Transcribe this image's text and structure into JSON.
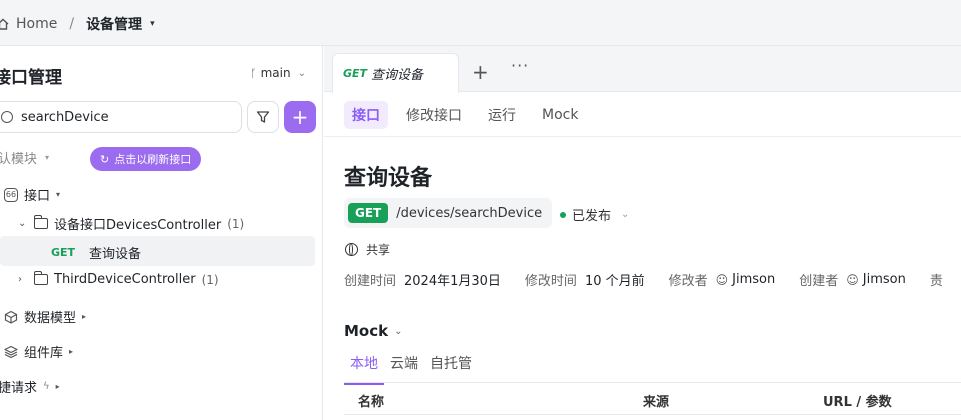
{
  "breadcrumb": {
    "home": "Home",
    "separator": "/",
    "current": "设备管理",
    "caret": "▾"
  },
  "sidebar": {
    "title": "接口管理",
    "branch": "main",
    "search": {
      "value": "searchDevice",
      "placeholder": ""
    },
    "module": "认模块",
    "refresh": "点击以刷新接口",
    "tree": {
      "api_root": "接口",
      "folder1": {
        "name": "设备接口DevicesController",
        "count": "(1)"
      },
      "endpoint": {
        "method": "GET",
        "name": "查询设备"
      },
      "folder2": {
        "name": "ThirdDeviceController",
        "count": "(1)"
      },
      "data_model": "数据模型",
      "components": "组件库",
      "quick_request": "捷请求"
    }
  },
  "tabbar": {
    "active_method": "GET",
    "active_title": "查询设备",
    "plus": "+",
    "more": "···"
  },
  "subtabs": [
    "接口",
    "修改接口",
    "运行",
    "Mock"
  ],
  "detail": {
    "title": "查询设备",
    "method": "GET",
    "url": "/devices/searchDevice",
    "status": "已发布",
    "share": "共享",
    "meta": {
      "created_label": "创建时间",
      "created_value": "2024年1月30日",
      "modified_label": "修改时间",
      "modified_value": "10 个月前",
      "modifier_label": "修改者",
      "modifier_value": "Jimson",
      "creator_label": "创建者",
      "creator_value": "Jimson",
      "owner_label": "责"
    }
  },
  "mock": {
    "heading": "Mock",
    "tabs": [
      "本地",
      "云端",
      "自托管"
    ],
    "columns": [
      "名称",
      "来源",
      "URL / 参数"
    ]
  },
  "colors": {
    "accent": "#9b6cf0",
    "get": "#18a058"
  }
}
